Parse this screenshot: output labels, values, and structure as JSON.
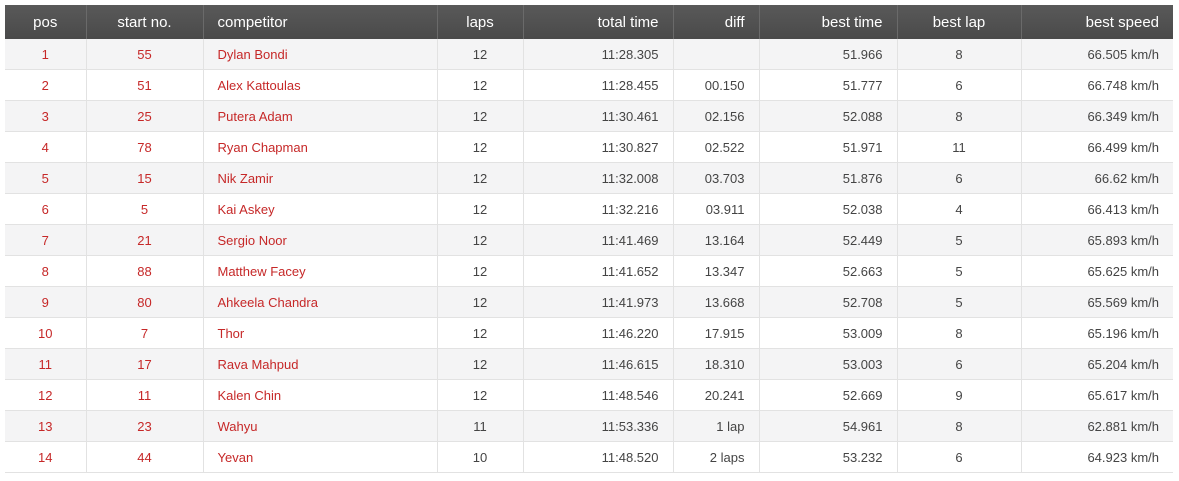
{
  "table": {
    "headers": {
      "pos": "pos",
      "start_no": "start no.",
      "competitor": "competitor",
      "laps": "laps",
      "total_time": "total time",
      "diff": "diff",
      "best_time": "best time",
      "best_lap": "best lap",
      "best_speed": "best speed"
    },
    "rows": [
      {
        "pos": "1",
        "start_no": "55",
        "competitor": "Dylan Bondi",
        "laps": "12",
        "total_time": "11:28.305",
        "diff": "",
        "best_time": "51.966",
        "best_lap": "8",
        "best_speed": "66.505 km/h"
      },
      {
        "pos": "2",
        "start_no": "51",
        "competitor": "Alex Kattoulas",
        "laps": "12",
        "total_time": "11:28.455",
        "diff": "00.150",
        "best_time": "51.777",
        "best_lap": "6",
        "best_speed": "66.748 km/h"
      },
      {
        "pos": "3",
        "start_no": "25",
        "competitor": "Putera Adam",
        "laps": "12",
        "total_time": "11:30.461",
        "diff": "02.156",
        "best_time": "52.088",
        "best_lap": "8",
        "best_speed": "66.349 km/h"
      },
      {
        "pos": "4",
        "start_no": "78",
        "competitor": "Ryan Chapman",
        "laps": "12",
        "total_time": "11:30.827",
        "diff": "02.522",
        "best_time": "51.971",
        "best_lap": "11",
        "best_speed": "66.499 km/h"
      },
      {
        "pos": "5",
        "start_no": "15",
        "competitor": "Nik Zamir",
        "laps": "12",
        "total_time": "11:32.008",
        "diff": "03.703",
        "best_time": "51.876",
        "best_lap": "6",
        "best_speed": "66.62 km/h"
      },
      {
        "pos": "6",
        "start_no": "5",
        "competitor": "Kai Askey",
        "laps": "12",
        "total_time": "11:32.216",
        "diff": "03.911",
        "best_time": "52.038",
        "best_lap": "4",
        "best_speed": "66.413 km/h"
      },
      {
        "pos": "7",
        "start_no": "21",
        "competitor": "Sergio Noor",
        "laps": "12",
        "total_time": "11:41.469",
        "diff": "13.164",
        "best_time": "52.449",
        "best_lap": "5",
        "best_speed": "65.893 km/h"
      },
      {
        "pos": "8",
        "start_no": "88",
        "competitor": "Matthew Facey",
        "laps": "12",
        "total_time": "11:41.652",
        "diff": "13.347",
        "best_time": "52.663",
        "best_lap": "5",
        "best_speed": "65.625 km/h"
      },
      {
        "pos": "9",
        "start_no": "80",
        "competitor": "Ahkeela Chandra",
        "laps": "12",
        "total_time": "11:41.973",
        "diff": "13.668",
        "best_time": "52.708",
        "best_lap": "5",
        "best_speed": "65.569 km/h"
      },
      {
        "pos": "10",
        "start_no": "7",
        "competitor": "Thor",
        "laps": "12",
        "total_time": "11:46.220",
        "diff": "17.915",
        "best_time": "53.009",
        "best_lap": "8",
        "best_speed": "65.196 km/h"
      },
      {
        "pos": "11",
        "start_no": "17",
        "competitor": "Rava Mahpud",
        "laps": "12",
        "total_time": "11:46.615",
        "diff": "18.310",
        "best_time": "53.003",
        "best_lap": "6",
        "best_speed": "65.204 km/h"
      },
      {
        "pos": "12",
        "start_no": "11",
        "competitor": "Kalen Chin",
        "laps": "12",
        "total_time": "11:48.546",
        "diff": "20.241",
        "best_time": "52.669",
        "best_lap": "9",
        "best_speed": "65.617 km/h"
      },
      {
        "pos": "13",
        "start_no": "23",
        "competitor": "Wahyu",
        "laps": "11",
        "total_time": "11:53.336",
        "diff": "1 lap",
        "best_time": "54.961",
        "best_lap": "8",
        "best_speed": "62.881 km/h"
      },
      {
        "pos": "14",
        "start_no": "44",
        "competitor": "Yevan",
        "laps": "10",
        "total_time": "11:48.520",
        "diff": "2 laps",
        "best_time": "53.232",
        "best_lap": "6",
        "best_speed": "64.923 km/h"
      }
    ]
  },
  "colors": {
    "header_bg": "#4f4f4f",
    "header_text": "#ffffff",
    "accent_red": "#c62828",
    "row_alt": "#f4f4f5",
    "cell_text": "#444444"
  }
}
